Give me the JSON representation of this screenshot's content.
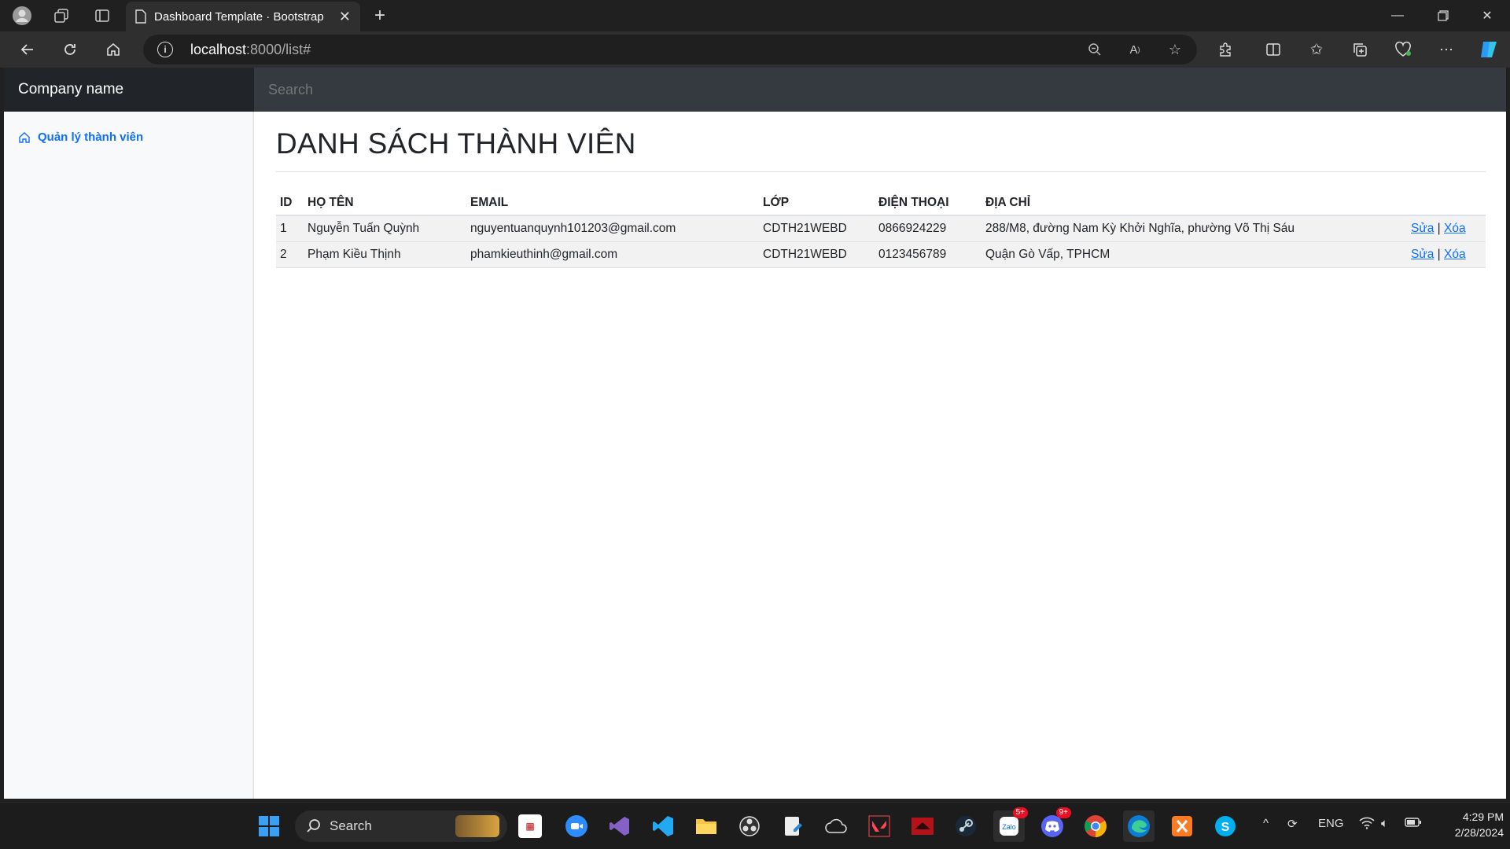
{
  "browser": {
    "tab_title": "Dashboard Template · Bootstrap",
    "url_host": "localhost",
    "url_path": ":8000/list#"
  },
  "page": {
    "brand": "Company name",
    "search_placeholder": "Search",
    "sidebar": {
      "items": [
        {
          "label": "Quản lý thành viên",
          "icon": "home-icon"
        }
      ]
    },
    "title": "DANH SÁCH THÀNH VIÊN",
    "table": {
      "headers": [
        "ID",
        "HỌ TÊN",
        "EMAIL",
        "LỚP",
        "ĐIỆN THOẠI",
        "ĐỊA CHỈ"
      ],
      "rows": [
        {
          "id": "1",
          "name": "Nguyễn Tuấn Quỳnh",
          "email": "nguyentuanquynh101203@gmail.com",
          "class": "CDTH21WEBD",
          "phone": "0866924229",
          "address": "288/M8, đường Nam Kỳ Khởi Nghĩa, phường Võ Thị Sáu",
          "edit": "Sửa",
          "sep": "|",
          "delete": "Xóa"
        },
        {
          "id": "2",
          "name": "Phạm Kiều Thịnh",
          "email": "phamkieuthinh@gmail.com",
          "class": "CDTH21WEBD",
          "phone": "0123456789",
          "address": "Quận Gò Vấp, TPHCM",
          "edit": "Sửa",
          "sep": "|",
          "delete": "Xóa"
        }
      ]
    }
  },
  "taskbar": {
    "search_label": "Search",
    "language": "ENG",
    "time": "4:29 PM",
    "date": "2/28/2024",
    "zalo_badge": "5+",
    "discord_badge": "9+"
  },
  "colors": {
    "link": "#0d6efd",
    "topbar": "#343a40",
    "brand_bg": "#212529"
  }
}
